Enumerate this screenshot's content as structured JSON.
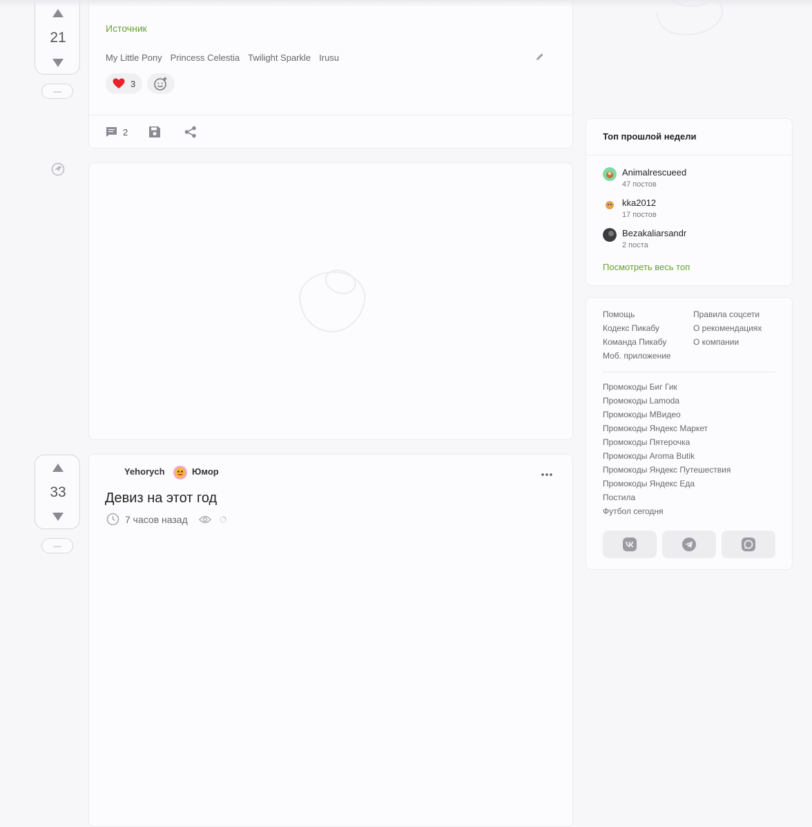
{
  "colors": {
    "accent_green": "#66a12e",
    "heart_red": "#e8212b"
  },
  "posts": [
    {
      "rating": "21",
      "source_label": "Источник",
      "tags": [
        "My Little Pony",
        "Princess Celestia",
        "Twilight Sparkle",
        "Irusu"
      ],
      "reaction_count": "3",
      "comments_count": "2"
    },
    {
      "rating": "33",
      "author": "Yehorych",
      "community": "Юмор",
      "title": "Девиз на этот год",
      "time": "7 часов назад"
    }
  ],
  "hide_label": "—",
  "sidebar": {
    "top_title": "Топ прошлой недели",
    "top_users": [
      {
        "name": "Animalrescueed",
        "posts": "47 постов"
      },
      {
        "name": "kka2012",
        "posts": "17 постов"
      },
      {
        "name": "Bezakaliarsandr",
        "posts": "2 поста"
      }
    ],
    "see_all": "Посмотреть весь топ",
    "links_left": [
      "Помощь",
      "Кодекс Пикабу",
      "Команда Пикабу",
      "Моб. приложение"
    ],
    "links_right": [
      "Правила соцсети",
      "О рекомендациях",
      "О компании"
    ],
    "promo_links": [
      "Промокоды Биг Гик",
      "Промокоды Lamoda",
      "Промокоды МВидео",
      "Промокоды Яндекс Маркет",
      "Промокоды Пятерочка",
      "Промокоды Aroma Butik",
      "Промокоды Яндекс Путешествия",
      "Промокоды Яндекс Еда",
      "Постила",
      "Футбол сегодня"
    ],
    "social_icons": [
      "vk-icon",
      "telegram-icon",
      "dzen-icon"
    ]
  }
}
